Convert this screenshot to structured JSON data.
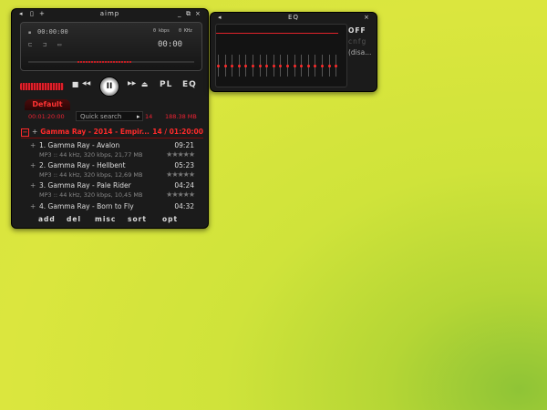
{
  "player": {
    "title": "aimp",
    "time": "00:00:00",
    "kbps": "0 kbps",
    "khz": "0 KHz",
    "counter": "00:00",
    "controls": {
      "stop": "■",
      "prev": "◀◀",
      "play": "II",
      "next": "▶▶",
      "eject": "⏏"
    },
    "pl_button": "PL",
    "eq_button": "EQ"
  },
  "playlist": {
    "tab": "Default",
    "elapsed": "00:01:20:00",
    "search_placeholder": "Quick search",
    "count": "14",
    "size": "188.38 MB",
    "group": "Gamma Ray - 2014 - Empir...",
    "group_summary": "14 / 01:20:00",
    "tracks": [
      {
        "title": "1. Gamma Ray - Avalon",
        "duration": "09:21",
        "info": "MP3 :: 44 kHz, 320 kbps, 21,77 MB"
      },
      {
        "title": "2. Gamma Ray - Hellbent",
        "duration": "05:23",
        "info": "MP3 :: 44 kHz, 320 kbps, 12,69 MB"
      },
      {
        "title": "3. Gamma Ray - Pale Rider",
        "duration": "04:24",
        "info": "MP3 :: 44 kHz, 320 kbps, 10,45 MB"
      },
      {
        "title": "4. Gamma Ray - Born to Fly",
        "duration": "04:32",
        "info": ""
      }
    ],
    "stars": "★★★★★",
    "bottom": {
      "add": "add",
      "del": "del",
      "misc": "misc",
      "sort": "sort",
      "opt": "opt"
    }
  },
  "eq": {
    "title": "EQ",
    "off": "OFF",
    "cnfg": "cnfg",
    "disabled": "(disa..."
  },
  "colors": {
    "accent": "#ff2a2a",
    "bg": "#1b1b1b"
  }
}
